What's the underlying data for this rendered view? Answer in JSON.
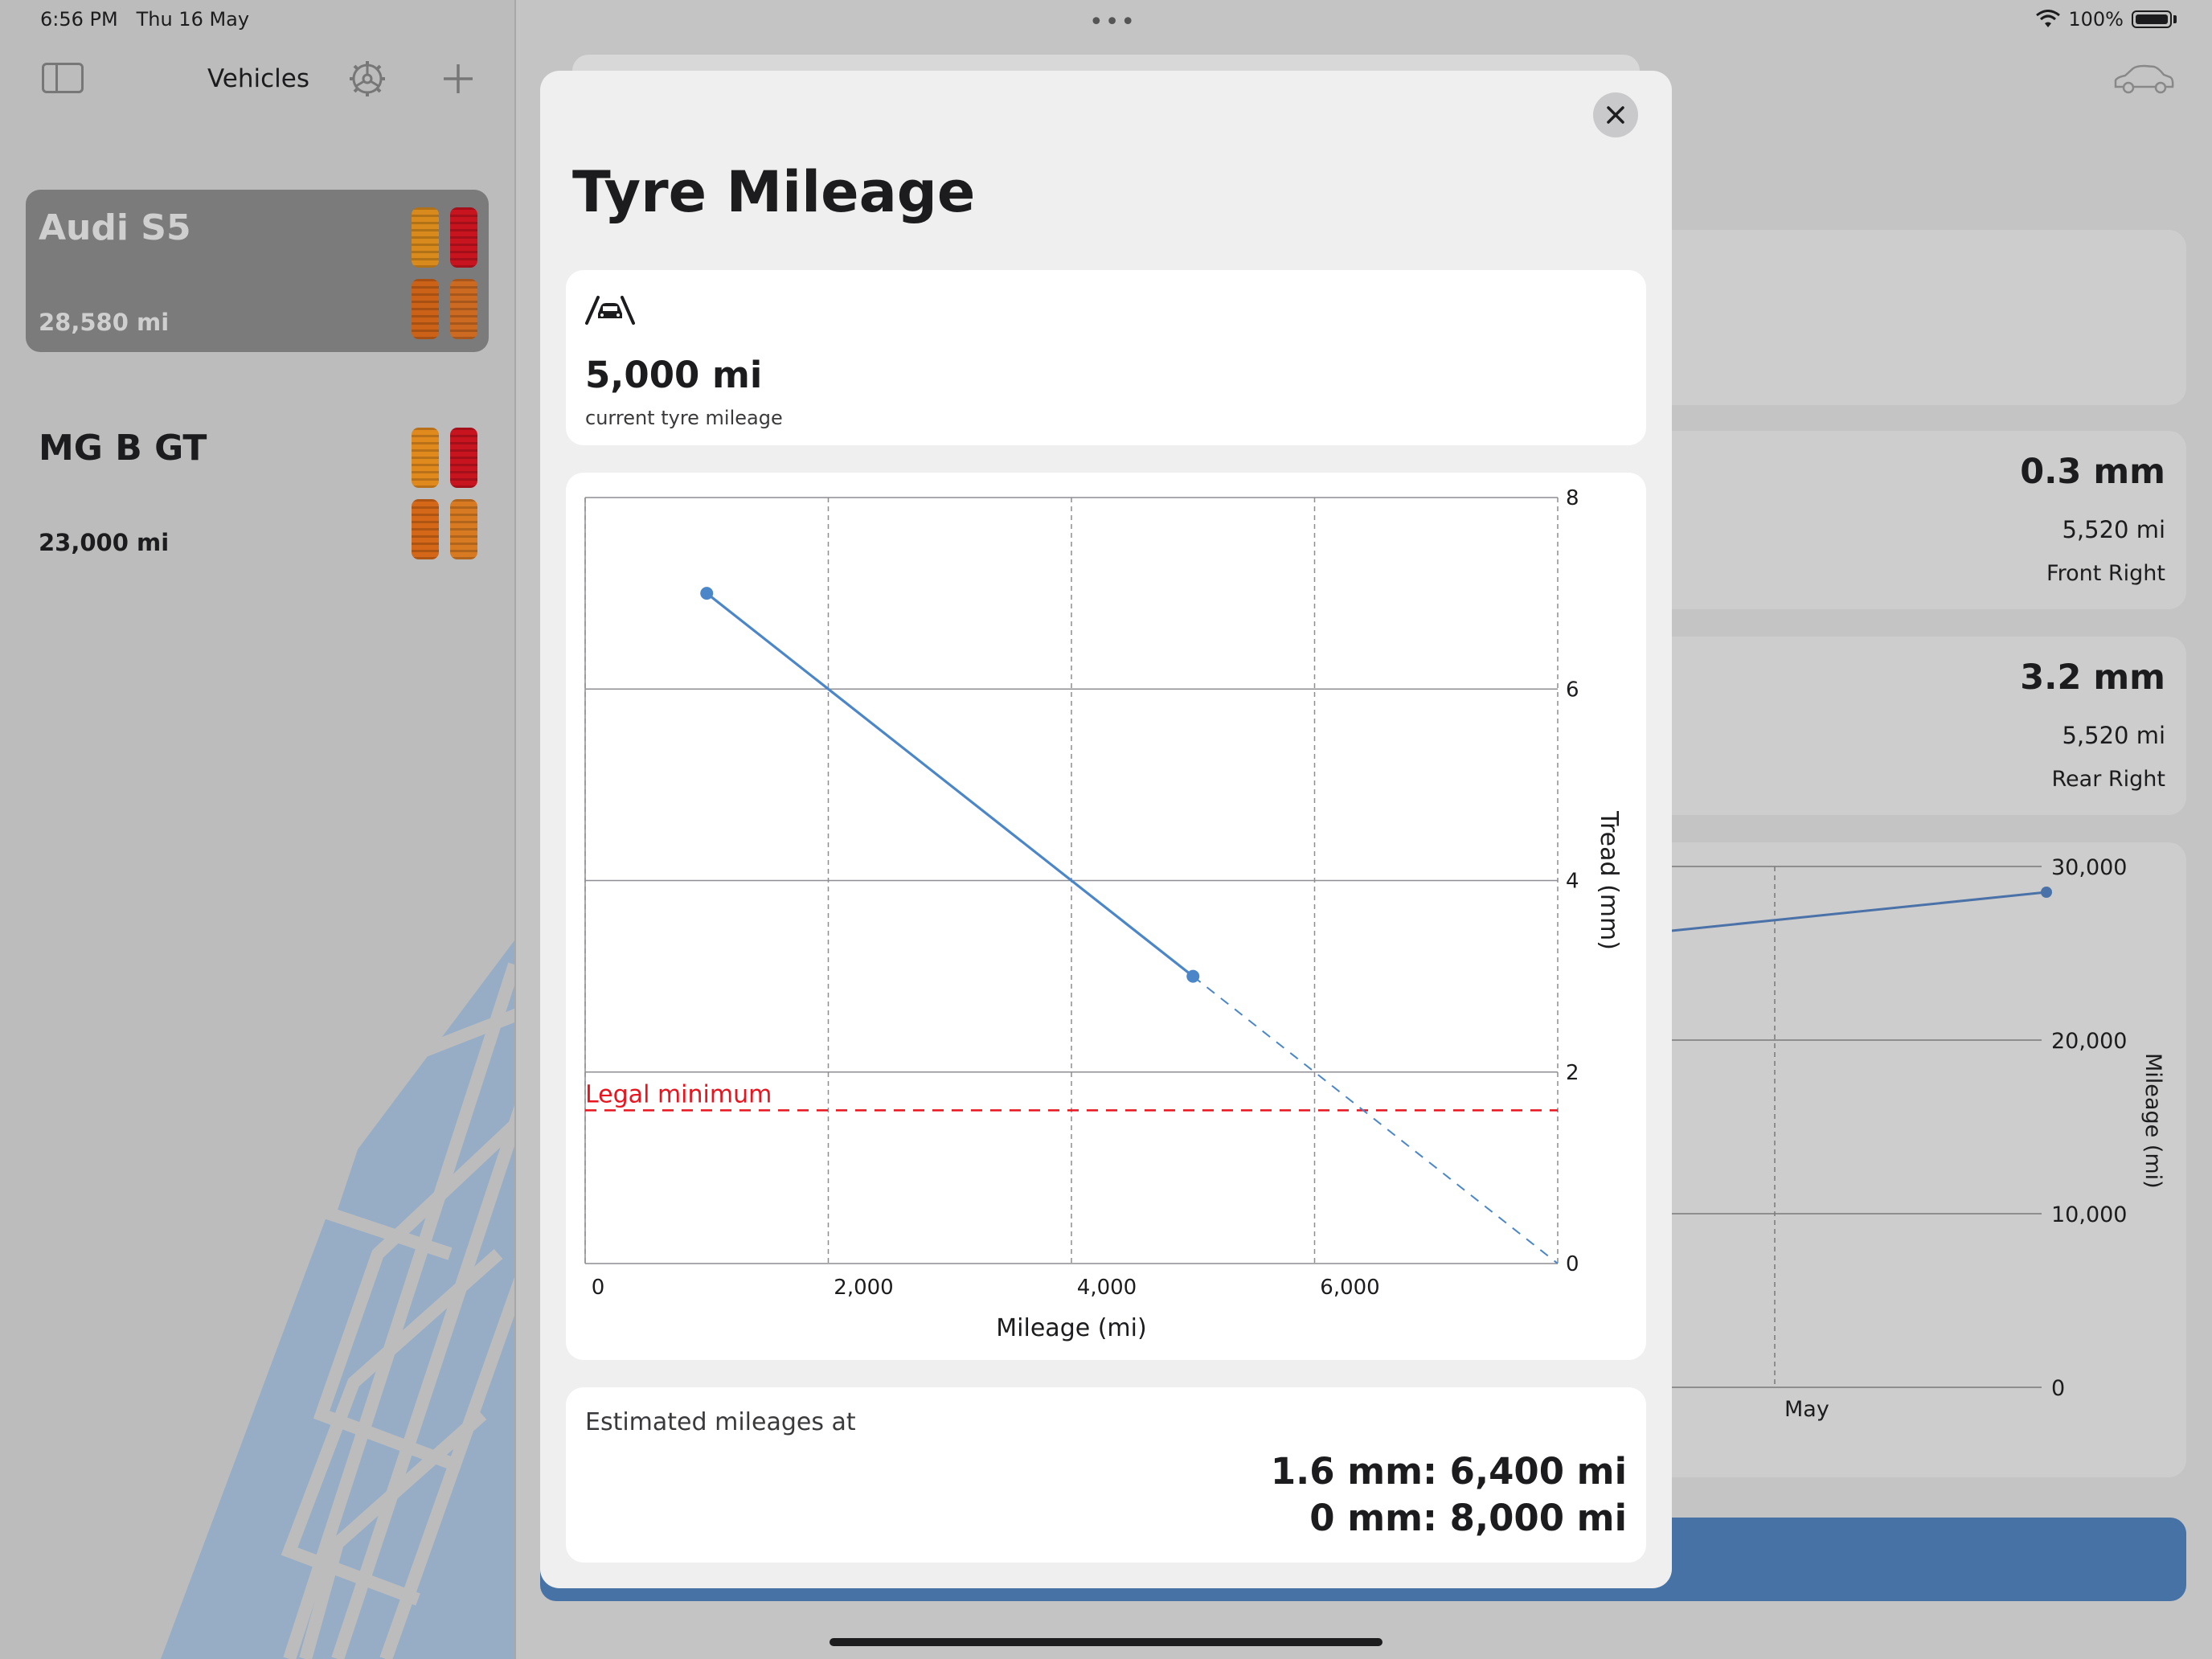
{
  "status_bar": {
    "time": "6:56 PM",
    "date": "Thu 16 May",
    "battery": "100%",
    "icons": [
      "wifi-icon",
      "battery-icon"
    ]
  },
  "sidebar": {
    "title": "Vehicles",
    "toggle_icon": "sidebar-toggle-icon",
    "settings_icon": "steering-wheel-gear-icon",
    "add_icon": "plus-icon",
    "vehicles": [
      {
        "name": "Audi S5",
        "mileage": "28,580 mi",
        "selected": true,
        "tyre_colors": [
          "#d88a1c",
          "#c8141e",
          "#cc6218",
          "#cc6a22"
        ]
      },
      {
        "name": "MG B GT",
        "mileage": "23,000 mi",
        "selected": false,
        "tyre_colors": [
          "#e08a1e",
          "#c8141e",
          "#d46818",
          "#d87a22"
        ]
      }
    ]
  },
  "background_detail": {
    "car_icon": "car-outline-icon",
    "tyre_cards": [
      {
        "tread": "0.3 mm",
        "mileage": "5,520 mi",
        "position": "Front Right"
      },
      {
        "tread": "3.2 mm",
        "mileage": "5,520 mi",
        "position": "Rear Right"
      }
    ],
    "mini_chart": {
      "y_ticks": [
        "30,000",
        "20,000",
        "10,000",
        "0"
      ],
      "y_label": "Mileage (mi)",
      "x_tick": "May"
    }
  },
  "sheet": {
    "close_icon": "close-icon",
    "title": "Tyre Mileage",
    "current": {
      "icon": "road-car-icon",
      "value": "5,000 mi",
      "caption": "current tyre mileage"
    },
    "estimates": {
      "title": "Estimated mileages at",
      "lines": [
        "1.6 mm: 6,400 mi",
        "0 mm: 8,000 mi"
      ]
    }
  },
  "chart_data": {
    "type": "line",
    "xlabel": "Mileage (mi)",
    "ylabel": "Tread (mm)",
    "xlim": [
      0,
      8000
    ],
    "ylim": [
      0,
      8
    ],
    "x_ticks": [
      0,
      2000,
      4000,
      6000
    ],
    "x_tick_labels": [
      "0",
      "2,000",
      "4,000",
      "6,000"
    ],
    "y_ticks": [
      0,
      2,
      4,
      6,
      8
    ],
    "y_tick_labels": [
      "0",
      "2",
      "4",
      "6",
      "8"
    ],
    "grid": true,
    "series": [
      {
        "style": "solid",
        "color": "#4a86c8",
        "x": [
          1000,
          5000
        ],
        "y": [
          7.0,
          3.0
        ],
        "markers": true
      },
      {
        "style": "dashed",
        "color": "#4a86c8",
        "x": [
          5000,
          8000
        ],
        "y": [
          3.0,
          0.0
        ],
        "markers": false
      }
    ],
    "threshold": {
      "label": "Legal minimum",
      "y": 1.6,
      "color": "#e8141e"
    }
  }
}
